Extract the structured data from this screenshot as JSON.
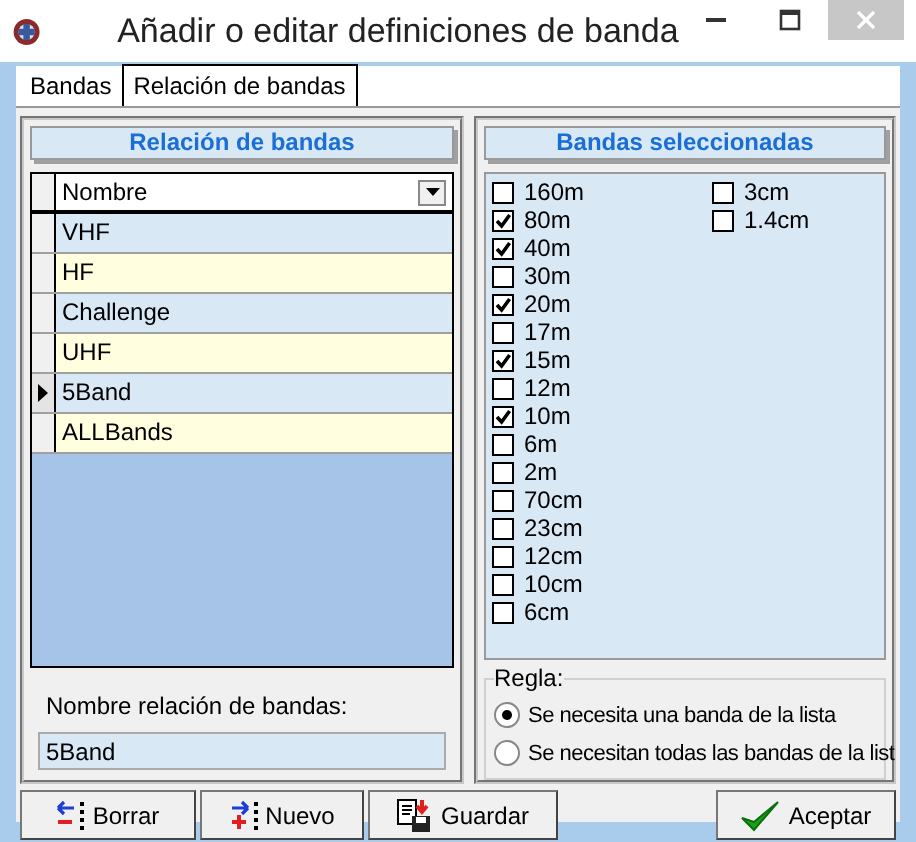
{
  "window": {
    "title": "Añadir o editar definiciones de banda"
  },
  "tabs": [
    {
      "label": "Bandas",
      "selected": false
    },
    {
      "label": "Relación de bandas",
      "selected": true
    }
  ],
  "list_panel": {
    "title": "Relación de bandas",
    "column": "Nombre",
    "rows": [
      {
        "name": "VHF",
        "selected": false
      },
      {
        "name": "HF",
        "selected": false
      },
      {
        "name": "Challenge",
        "selected": false
      },
      {
        "name": "UHF",
        "selected": false
      },
      {
        "name": "5Band",
        "selected": true
      },
      {
        "name": "ALLBands",
        "selected": false
      }
    ],
    "name_label": "Nombre relación de bandas:",
    "name_value": "5Band"
  },
  "bands_panel": {
    "title": "Bandas seleccionadas",
    "bands": [
      {
        "label": "160m",
        "checked": false
      },
      {
        "label": "80m",
        "checked": true
      },
      {
        "label": "40m",
        "checked": true
      },
      {
        "label": "30m",
        "checked": false
      },
      {
        "label": "20m",
        "checked": true
      },
      {
        "label": "17m",
        "checked": false
      },
      {
        "label": "15m",
        "checked": true
      },
      {
        "label": "12m",
        "checked": false
      },
      {
        "label": "10m",
        "checked": true
      },
      {
        "label": "6m",
        "checked": false
      },
      {
        "label": "2m",
        "checked": false
      },
      {
        "label": "70cm",
        "checked": false
      },
      {
        "label": "23cm",
        "checked": false
      },
      {
        "label": "12cm",
        "checked": false
      },
      {
        "label": "10cm",
        "checked": false
      },
      {
        "label": "6cm",
        "checked": false
      },
      {
        "label": "3cm",
        "checked": false
      },
      {
        "label": "1.4cm",
        "checked": false
      }
    ],
    "rule": {
      "label": "Regla:",
      "options": [
        {
          "label": "Se necesita una banda de la lista",
          "selected": true
        },
        {
          "label": "Se necesitan todas las bandas de la list",
          "selected": false
        }
      ]
    }
  },
  "buttons": [
    {
      "label": "Borrar",
      "kind": "delete"
    },
    {
      "label": "Nuevo",
      "kind": "new"
    },
    {
      "label": "Guardar",
      "kind": "save"
    },
    {
      "label": "Aceptar",
      "kind": "accept"
    }
  ]
}
